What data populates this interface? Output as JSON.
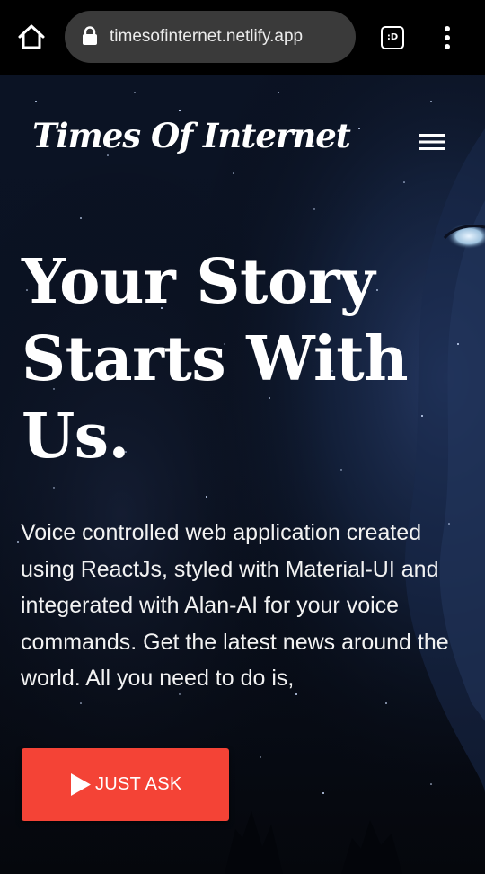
{
  "browser": {
    "url": "timesofinternet.netlify.app",
    "tab_count": ":D",
    "icons": {
      "home": "home-icon",
      "lock": "lock-icon",
      "menu": "kebab-menu-icon"
    }
  },
  "site": {
    "brand": "Times Of Internet",
    "menu_icon": "hamburger-menu-icon"
  },
  "hero": {
    "heading_line1": "Your Story",
    "heading_line2": "Starts With",
    "heading_line3": "Us.",
    "description": "Voice controlled web application created using ReactJs, styled with Material-UI and integerated with Alan-AI for your voice commands. Get the latest news around the world. All you need to do is,",
    "cta_label": "JUST ASK",
    "cta_icon": "play-icon"
  },
  "colors": {
    "browser_bar": "#000000",
    "url_pill": "#3a3a3a",
    "cta": "#f44336",
    "hero_bg": "#06080f"
  }
}
